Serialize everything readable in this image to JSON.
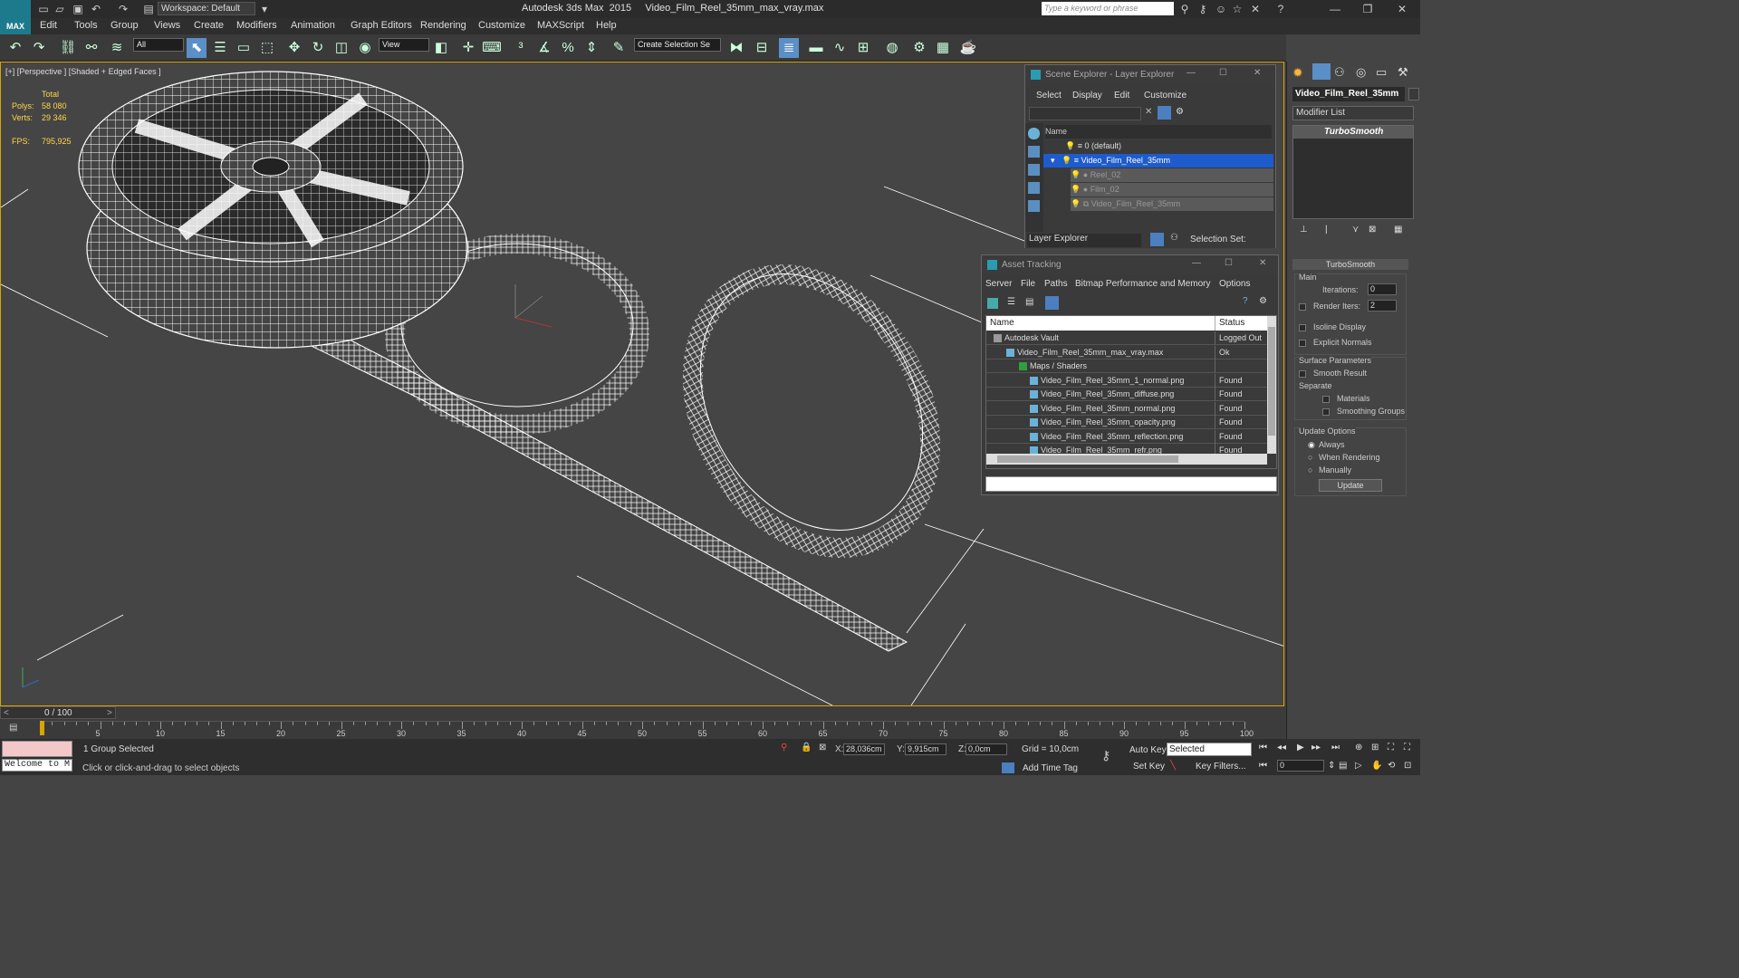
{
  "app": {
    "logo": "MAX",
    "workspace": "Workspace: Default",
    "title": "Autodesk 3ds Max  2015     Video_Film_Reel_35mm_max_vray.max",
    "search_placeholder": "Type a keyword or phrase"
  },
  "menu": [
    "Edit",
    "Tools",
    "Group",
    "Views",
    "Create",
    "Modifiers",
    "Animation",
    "Graph Editors",
    "Rendering",
    "Customize",
    "MAXScript",
    "Help"
  ],
  "toolbar": {
    "selection_filter": "All",
    "ref_coord": "View",
    "selection_set": "Create Selection Se"
  },
  "viewport": {
    "label": "[+] [Perspective ] [Shaded + Edged Faces ]",
    "total_label": "Total",
    "polys_label": "Polys:",
    "polys": "58 080",
    "verts_label": "Verts:",
    "verts": "29 346",
    "fps_label": "FPS:",
    "fps": "795,925"
  },
  "scene_explorer": {
    "title": "Scene Explorer - Layer Explorer",
    "menu": [
      "Select",
      "Display",
      "Edit",
      "Customize"
    ],
    "col_name": "Name",
    "items": [
      "0 (default)",
      "Video_Film_Reel_35mm",
      "Reel_02",
      "Film_02",
      "Video_Film_Reel_35mm"
    ],
    "footer_mode": "Layer Explorer",
    "selection_set": "Selection Set:"
  },
  "asset_tracking": {
    "title": "Asset Tracking",
    "menu": [
      "Server",
      "File",
      "Paths",
      "Bitmap Performance and Memory",
      "Options"
    ],
    "col_name": "Name",
    "col_status": "Status",
    "rows": [
      {
        "name": "Autodesk Vault",
        "status": "Logged Out"
      },
      {
        "name": "Video_Film_Reel_35mm_max_vray.max",
        "status": "Ok"
      },
      {
        "name": "Maps / Shaders",
        "status": ""
      },
      {
        "name": "Video_Film_Reel_35mm_1_normal.png",
        "status": "Found"
      },
      {
        "name": "Video_Film_Reel_35mm_diffuse.png",
        "status": "Found"
      },
      {
        "name": "Video_Film_Reel_35mm_normal.png",
        "status": "Found"
      },
      {
        "name": "Video_Film_Reel_35mm_opacity.png",
        "status": "Found"
      },
      {
        "name": "Video_Film_Reel_35mm_reflection.png",
        "status": "Found"
      },
      {
        "name": "Video_Film_Reel_35mm_refr.png",
        "status": "Found"
      }
    ]
  },
  "command_panel": {
    "object_name": "Video_Film_Reel_35mm",
    "modifier_list": "Modifier List",
    "stack_item": "TurboSmooth",
    "rollout": "TurboSmooth",
    "main": "Main",
    "iterations_label": "Iterations:",
    "iterations": "0",
    "render_iters_label": "Render Iters:",
    "render_iters": "2",
    "isoline": "Isoline Display",
    "explicit_normals": "Explicit Normals",
    "surface_params": "Surface Parameters",
    "smooth_result": "Smooth Result",
    "separate": "Separate",
    "materials": "Materials",
    "smoothing_groups": "Smoothing Groups",
    "update_options": "Update Options",
    "always": "Always",
    "when_rendering": "When Rendering",
    "manually": "Manually",
    "update": "Update"
  },
  "timeline": {
    "frame": "0 / 100",
    "ticks": [
      "5",
      "10",
      "15",
      "20",
      "25",
      "30",
      "35",
      "40",
      "45",
      "50",
      "55",
      "60",
      "65",
      "70",
      "75",
      "80",
      "85",
      "90",
      "95",
      "100"
    ]
  },
  "status": {
    "maxscript": "Welcome to M",
    "selected": "1 Group Selected",
    "prompt": "Click or click-and-drag to select objects",
    "x_label": "X:",
    "x": "28,036cm",
    "y_label": "Y:",
    "y": "9,915cm",
    "z_label": "Z:",
    "z": "0,0cm",
    "grid": "Grid = 10,0cm",
    "add_time_tag": "Add Time Tag",
    "auto_key": "Auto Key",
    "key_mode": "Selected",
    "set_key": "Set Key",
    "key_filters": "Key Filters...",
    "frame_field": "0"
  }
}
